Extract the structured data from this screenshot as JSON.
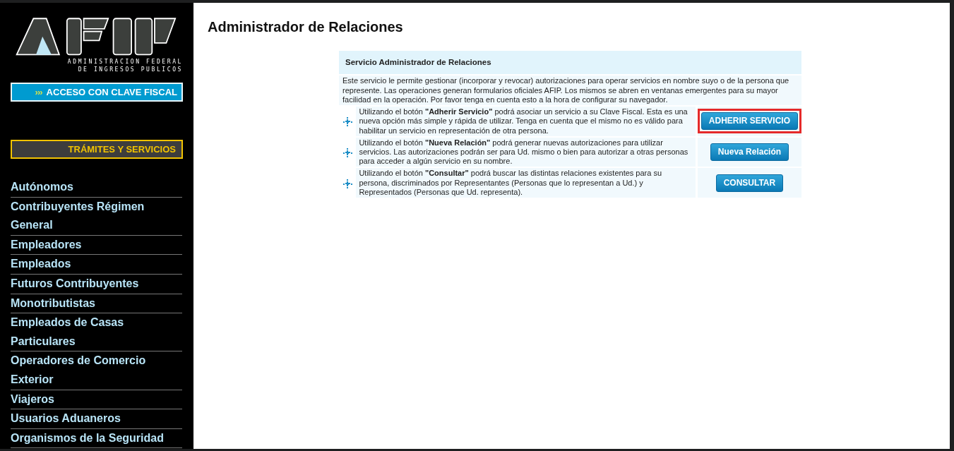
{
  "logo": {
    "subtitle_lines": [
      "ADMINISTRACION FEDERAL",
      "DE INGRESOS PUBLICOS"
    ]
  },
  "sidebar": {
    "login_button": {
      "arrows": "›››",
      "label": "ACCESO CON CLAVE FISCAL"
    },
    "section_button": "TRÁMITES Y SERVICIOS",
    "items": [
      "Autónomos",
      "Contribuyentes Régimen General",
      "Empleadores",
      "Empleados",
      "Futuros Contribuyentes",
      "Monotributistas",
      "Empleados de Casas Particulares",
      "Operadores de Comercio Exterior",
      "Viajeros",
      "Usuarios Aduaneros",
      "Organismos de la Seguridad"
    ]
  },
  "page_title": "Administrador de Relaciones",
  "panel": {
    "title": "Servicio Administrador de Relaciones",
    "intro": "Este servicio le permite gestionar (incorporar y revocar) autorizaciones para operar servicios en nombre suyo o de la persona que represente. Las operaciones generan formularios oficiales AFIP. Los mismos se abren en ventanas emergentes para su mayor facilidad en la operación. Por favor tenga en cuenta esto a la hora de configurar su navegador.",
    "actions": [
      {
        "text": "Utilizando el botón **\"Adherir Servicio\"** podrá asociar un servicio a su Clave Fiscal. Esta es una nueva opción más simple y rápida de utilizar. Tenga en cuenta que el mismo no es válido para habilitar un servicio en representación de otra persona.",
        "button": "ADHERIR SERVICIO",
        "highlighted": true
      },
      {
        "text": "Utilizando el botón **\"Nueva Relación\"** podrá generar nuevas autorizaciones para utilizar servicios. Las autorizaciones podrán ser para Ud. mismo o bien para autorizar a otras personas para acceder a algún servicio en su nombre.",
        "button": "Nueva Relación",
        "highlighted": false
      },
      {
        "text": "Utilizando el botón **\"Consultar\"** podrá buscar las distintas relaciones existentes para su persona, discriminados por Representantes (Personas que lo representan a Ud.) y Representados (Personas que Ud. representa).",
        "button": "CONSULTAR",
        "highlighted": false
      }
    ]
  }
}
